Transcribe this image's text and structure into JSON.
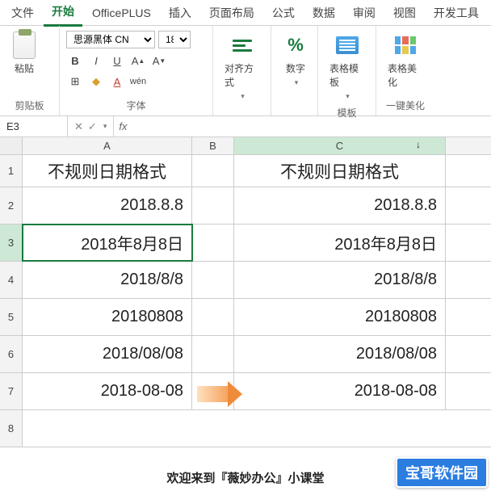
{
  "tabs": [
    "文件",
    "开始",
    "OfficePLUS",
    "插入",
    "页面布局",
    "公式",
    "数据",
    "审阅",
    "视图",
    "开发工具"
  ],
  "active_tab_index": 1,
  "ribbon": {
    "clipboard": {
      "label": "剪贴板",
      "paste_label": "粘贴"
    },
    "font": {
      "label": "字体",
      "font_name": "思源黑体 CN",
      "font_size": "18",
      "buttons": {
        "bold": "B",
        "italic": "I",
        "underline": "U",
        "grow": "A",
        "shrink": "A",
        "border": "⊞",
        "fill": "◆",
        "color": "A",
        "wen": "wén"
      }
    },
    "align": {
      "label": "对齐方式"
    },
    "number": {
      "label": "数字"
    },
    "template": {
      "group_label": "模板",
      "btn_label": "表格模板"
    },
    "beautify": {
      "group_label": "一键美化",
      "btn_label": "表格美化"
    }
  },
  "namebox": {
    "cell_ref": "E3",
    "fx": "fx",
    "cancel": "✕",
    "confirm": "✓"
  },
  "columns": {
    "a": "A",
    "b": "B",
    "c": "C"
  },
  "row_numbers": [
    "1",
    "2",
    "3",
    "4",
    "5",
    "6",
    "7",
    "8"
  ],
  "header_row": {
    "a": "不规则日期格式",
    "c": "不规则日期格式"
  },
  "data_rows": [
    {
      "a": "2018.8.8",
      "c": "2018.8.8"
    },
    {
      "a": "2018年8月8日",
      "c": "2018年8月8日"
    },
    {
      "a": "2018/8/8",
      "c": "2018/8/8"
    },
    {
      "a": "20180808",
      "c": "20180808"
    },
    {
      "a": "2018/08/08",
      "c": "2018/08/08"
    },
    {
      "a": "2018-08-08",
      "c": "2018-08-08"
    }
  ],
  "footer_text": "欢迎来到『薇妙办公』小课堂",
  "badge_text": "宝哥软件园"
}
